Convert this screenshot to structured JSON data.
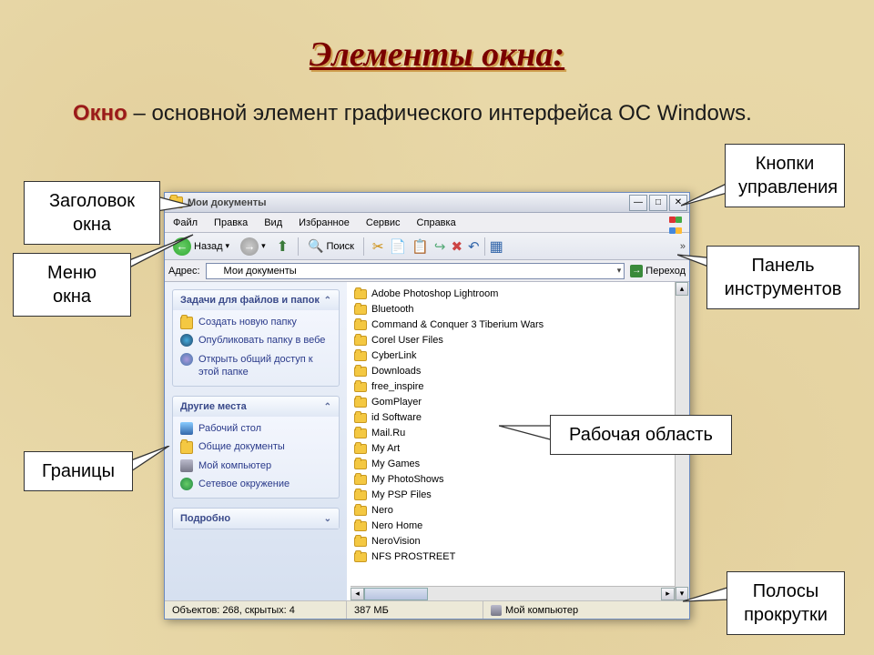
{
  "slide_title": "Элементы окна:",
  "intro": {
    "keyword": "Окно",
    "rest": " – основной элемент графического интерфейса ОС Windows."
  },
  "callouts": {
    "title": "Заголовок окна",
    "menu": "Меню окна",
    "borders": "Границы",
    "controls": "Кнопки управления",
    "toolbar": "Панель инструментов",
    "workarea": "Рабочая область",
    "scrollbars": "Полосы прокрутки"
  },
  "window": {
    "title": "Мои документы",
    "menus": [
      "Файл",
      "Правка",
      "Вид",
      "Избранное",
      "Сервис",
      "Справка"
    ],
    "toolbar": {
      "back": "Назад",
      "search": "Поиск"
    },
    "address": {
      "label": "Адрес:",
      "value": "Мои документы",
      "go": "Переход"
    },
    "tasks": {
      "box1": {
        "header": "Задачи для файлов и папок",
        "items": [
          "Создать новую папку",
          "Опубликовать папку в вебе",
          "Открыть общий доступ к этой папке"
        ]
      },
      "box2": {
        "header": "Другие места",
        "items": [
          "Рабочий стол",
          "Общие документы",
          "Мой компьютер",
          "Сетевое окружение"
        ]
      },
      "box3": {
        "header": "Подробно"
      }
    },
    "files": [
      "Adobe Photoshop Lightroom",
      "Bluetooth",
      "Command & Conquer 3 Tiberium Wars",
      "Corel User Files",
      "CyberLink",
      "Downloads",
      "free_inspire",
      "GomPlayer",
      "id Software",
      "Mail.Ru",
      "My Art",
      "My Games",
      "My PhotoShows",
      "My PSP Files",
      "Nero",
      "Nero Home",
      "NeroVision",
      "NFS PROSTREET"
    ],
    "statusbar": {
      "objects": "Объектов: 268, скрытых: 4",
      "size": "387 МБ",
      "location": "Мой компьютер"
    }
  }
}
